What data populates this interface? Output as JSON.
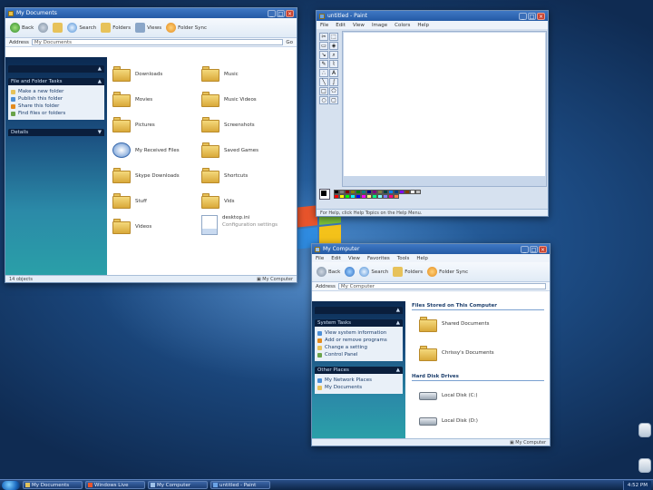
{
  "colors": {
    "desktop": "#1d4d86",
    "titlebar": "#245aa5",
    "taskpane": "#1b4f80",
    "folder": "#e7c25a"
  },
  "explorer_window": {
    "title": "My Documents",
    "toolbar": {
      "back": "Back",
      "search": "Search",
      "folders": "Folders",
      "views": "Views",
      "extra": "Folder Sync"
    },
    "address_label": "Address",
    "address": "My Documents",
    "go_label": "Go",
    "taskpane": {
      "top_header": "",
      "tasks_header": "File and Folder Tasks",
      "tasks": [
        "Make a new folder",
        "Publish this folder",
        "Share this folder",
        "Find files or folders"
      ],
      "details_header": "Details"
    },
    "icons": [
      {
        "label": "Downloads",
        "icon": "folder"
      },
      {
        "label": "Music",
        "icon": "folder"
      },
      {
        "label": "Movies",
        "icon": "folder"
      },
      {
        "label": "Music Videos",
        "icon": "folder"
      },
      {
        "label": "Pictures",
        "icon": "folder"
      },
      {
        "label": "Screenshots",
        "icon": "folder"
      },
      {
        "label": "My Received Files",
        "icon": "special"
      },
      {
        "label": "Saved Games",
        "icon": "folder"
      },
      {
        "label": "Skype Downloads",
        "icon": "folder"
      },
      {
        "label": "Shortcuts",
        "icon": "folder"
      },
      {
        "label": "Stuff",
        "icon": "folder"
      },
      {
        "label": "Vids",
        "icon": "folder"
      },
      {
        "label": "Videos",
        "icon": "folder"
      },
      {
        "label": "desktop.ini",
        "icon": "file",
        "sub": "Configuration settings"
      }
    ],
    "status_left": "14 objects",
    "status_right": "My Computer"
  },
  "paint_window": {
    "title": "untitled - Paint",
    "menu": [
      "File",
      "Edit",
      "View",
      "Image",
      "Colors",
      "Help"
    ],
    "tools": [
      "select-free",
      "select-rect",
      "eraser",
      "fill",
      "picker",
      "zoom",
      "pencil",
      "brush",
      "airbrush",
      "text",
      "line",
      "curve",
      "rect",
      "poly",
      "ellipse",
      "round-rect"
    ],
    "palette": [
      "#000000",
      "#808080",
      "#800000",
      "#808000",
      "#008000",
      "#008080",
      "#000080",
      "#800080",
      "#808040",
      "#004040",
      "#0080ff",
      "#004080",
      "#8000ff",
      "#804000",
      "#ffffff",
      "#c0c0c0",
      "#ff0000",
      "#ffff00",
      "#00ff00",
      "#00ffff",
      "#0000ff",
      "#ff00ff",
      "#ffff80",
      "#00ff80",
      "#80ffff",
      "#8080ff",
      "#ff0080",
      "#ff8040"
    ],
    "status": "For Help, click Help Topics on the Help Menu."
  },
  "mycomputer_window": {
    "title": "My Computer",
    "menu": [
      "File",
      "Edit",
      "View",
      "Favorites",
      "Tools",
      "Help"
    ],
    "toolbar": {
      "back": "Back",
      "search": "Search",
      "folders": "Folders",
      "extra": "Folder Sync"
    },
    "address_label": "Address",
    "address": "My Computer",
    "section_files": "Files Stored on This Computer",
    "items_files": [
      "Shared Documents",
      "Chrissy's Documents"
    ],
    "section_drives": "Hard Disk Drives",
    "items_drives": [
      "Local Disk (C:)",
      "Local Disk (D:)"
    ],
    "taskpane": {
      "top_header": "",
      "tasks_header": "System Tasks",
      "tasks": [
        "View system information",
        "Add or remove programs",
        "Change a setting",
        "Control Panel"
      ],
      "places_header": "Other Places",
      "places": [
        "My Network Places",
        "My Documents"
      ]
    },
    "status_left": "",
    "status_right": "My Computer"
  },
  "taskbar": {
    "start": "start",
    "tasks": [
      "My Documents",
      "Windows Live",
      "My Computer",
      "untitled - Paint"
    ],
    "clock": "4:52 PM"
  }
}
